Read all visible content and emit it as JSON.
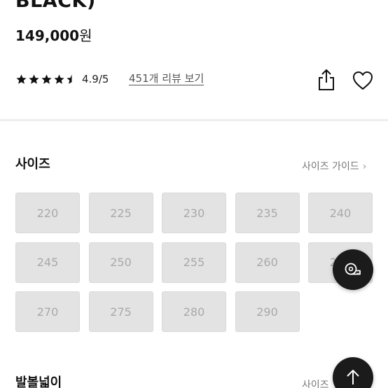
{
  "product": {
    "title": "BLACK)",
    "price_number": "149,000",
    "price_unit": "원"
  },
  "rating": {
    "stars_value": 4.5,
    "stars_max": 5,
    "score_text": "4.9/5",
    "review_link": "451개 리뷰 보기"
  },
  "size_section": {
    "title": "사이즈",
    "guide_link": "사이즈 가이드",
    "sizes": [
      "220",
      "225",
      "230",
      "235",
      "240",
      "245",
      "250",
      "255",
      "260",
      "265",
      "270",
      "275",
      "280",
      "290"
    ]
  },
  "width_section": {
    "title": "발볼넓이",
    "guide_link": "사이즈"
  },
  "icons": {
    "share": "share-icon",
    "wishlist": "heart-icon",
    "measure": "tape-measure-icon",
    "scroll_top": "arrow-up-icon",
    "guide_chevron": "chevron-right-icon"
  },
  "colors": {
    "size_disabled_bg": "#e3e3e3",
    "size_disabled_text": "#a9a9a9",
    "fab_bg": "#1b1b1b"
  }
}
